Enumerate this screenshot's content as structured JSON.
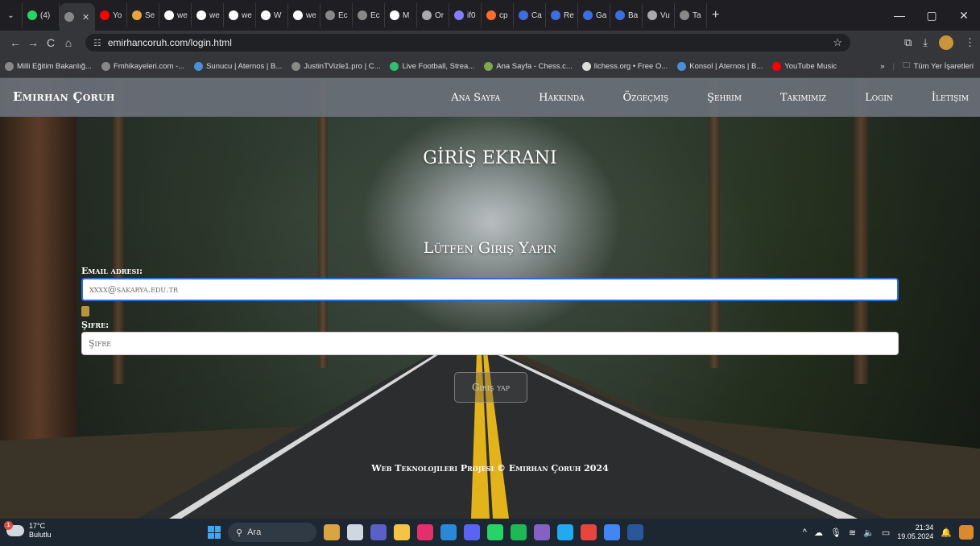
{
  "browser": {
    "tabs": [
      {
        "label": "(4)",
        "icon": "whatsapp-icon",
        "color": "#25d366"
      },
      {
        "label": "",
        "icon": "globe-icon",
        "color": "#888888",
        "active": true
      },
      {
        "label": "Yo",
        "icon": "youtube-icon",
        "color": "#ff0000"
      },
      {
        "label": "Se",
        "icon": "slack-icon",
        "color": "#e8a33c"
      },
      {
        "label": "we",
        "icon": "github-icon",
        "color": "#ffffff"
      },
      {
        "label": "we",
        "icon": "github-icon",
        "color": "#ffffff"
      },
      {
        "label": "we",
        "icon": "github-icon",
        "color": "#ffffff"
      },
      {
        "label": "W",
        "icon": "github-icon",
        "color": "#ffffff"
      },
      {
        "label": "we",
        "icon": "github-icon",
        "color": "#ffffff"
      },
      {
        "label": "Ec",
        "icon": "globe-icon",
        "color": "#888888"
      },
      {
        "label": "Ec",
        "icon": "globe-icon",
        "color": "#888888"
      },
      {
        "label": "M",
        "icon": "github-icon",
        "color": "#ffffff"
      },
      {
        "label": "Or",
        "icon": "openai-icon",
        "color": "#aaaaaa"
      },
      {
        "label": "if0",
        "icon": "infinity-icon",
        "color": "#8a7cff"
      },
      {
        "label": "cp",
        "icon": "cpanel-icon",
        "color": "#ff6c2c"
      },
      {
        "label": "Ca",
        "icon": "m-icon",
        "color": "#3b6fe0"
      },
      {
        "label": "Re",
        "icon": "m-icon",
        "color": "#3b6fe0"
      },
      {
        "label": "Ga",
        "icon": "m-icon",
        "color": "#3b6fe0"
      },
      {
        "label": "Ba",
        "icon": "m-icon",
        "color": "#3b6fe0"
      },
      {
        "label": "Vu",
        "icon": "openai-icon",
        "color": "#aaaaaa"
      },
      {
        "label": "Ta",
        "icon": "globe-icon",
        "color": "#888888"
      }
    ],
    "new_tab": "+",
    "window_controls": {
      "minimize": "—",
      "restore": "▢",
      "close": "✕"
    },
    "url": "emirhancoruh.com/login.html",
    "nav": {
      "back": "←",
      "forward": "→",
      "reload": "C",
      "home": "⌂"
    },
    "bookmarks": [
      {
        "label": "Milli Eğitim Bakanlığ...",
        "icon": "globe-icon",
        "color": "#888888"
      },
      {
        "label": "Fmhikayeleri.com -...",
        "icon": "globe-icon",
        "color": "#888888"
      },
      {
        "label": "Sunucu | Aternos | B...",
        "icon": "aternos-icon",
        "color": "#4a8fd8"
      },
      {
        "label": "JustinTVizle1.pro | C...",
        "icon": "globe-icon",
        "color": "#888888"
      },
      {
        "label": "Live Football, Strea...",
        "icon": "football-icon",
        "color": "#2fbf71"
      },
      {
        "label": "Ana Sayfa - Chess.c...",
        "icon": "chess-icon",
        "color": "#7fa650"
      },
      {
        "label": "lichess.org • Free O...",
        "icon": "lichess-icon",
        "color": "#dddddd"
      },
      {
        "label": "Konsol | Aternos | B...",
        "icon": "aternos-icon",
        "color": "#4a8fd8"
      },
      {
        "label": "YouTube Music",
        "icon": "youtube-music-icon",
        "color": "#ff0000"
      }
    ],
    "bookmarks_more": "»",
    "all_bookmarks": "Tüm Yer İşaretleri"
  },
  "site": {
    "brand": "Emirhan Çoruh",
    "menu": [
      "Ana Sayfa",
      "Hakkinda",
      "Özgeçmiş",
      "Şehrim",
      "Takimimiz",
      "Login",
      "İletişim"
    ],
    "title": "GİRİŞ EKRANI",
    "subtitle": "Lütfen Giriş Yapin",
    "email_label": "Email adresi:",
    "email_placeholder": "xxxx@sakarya.edu.tr",
    "password_label": "Şifre:",
    "password_placeholder": "Şifre",
    "submit_label": "Giriş yap",
    "footer": "Web Teknolojileri Projesi © Emirhan Çoruh 2024"
  },
  "taskbar": {
    "weather_temp": "17°C",
    "weather_desc": "Bulutlu",
    "weather_badge": "1",
    "search_label": "Ara",
    "apps": [
      {
        "icon": "widgets-icon",
        "color": "#d9a441"
      },
      {
        "icon": "taskview-icon",
        "color": "#cfd8e0"
      },
      {
        "icon": "teams-icon",
        "color": "#5b5fc7"
      },
      {
        "icon": "file-explorer-icon",
        "color": "#f4c542"
      },
      {
        "icon": "instagram-icon",
        "color": "#e1306c"
      },
      {
        "icon": "store-icon",
        "color": "#2b88d8"
      },
      {
        "icon": "discord-icon",
        "color": "#5865f2"
      },
      {
        "icon": "whatsapp-icon",
        "color": "#25d366"
      },
      {
        "icon": "spotify-icon",
        "color": "#1db954"
      },
      {
        "icon": "visual-studio-icon",
        "color": "#8661c5"
      },
      {
        "icon": "vscode-icon",
        "color": "#23a9f2"
      },
      {
        "icon": "chrome-icon",
        "color": "#e8453c"
      },
      {
        "icon": "chrome-profile-icon",
        "color": "#4285f4"
      },
      {
        "icon": "word-icon",
        "color": "#2b579a"
      }
    ],
    "time": "21:34",
    "date": "19.05.2024"
  }
}
